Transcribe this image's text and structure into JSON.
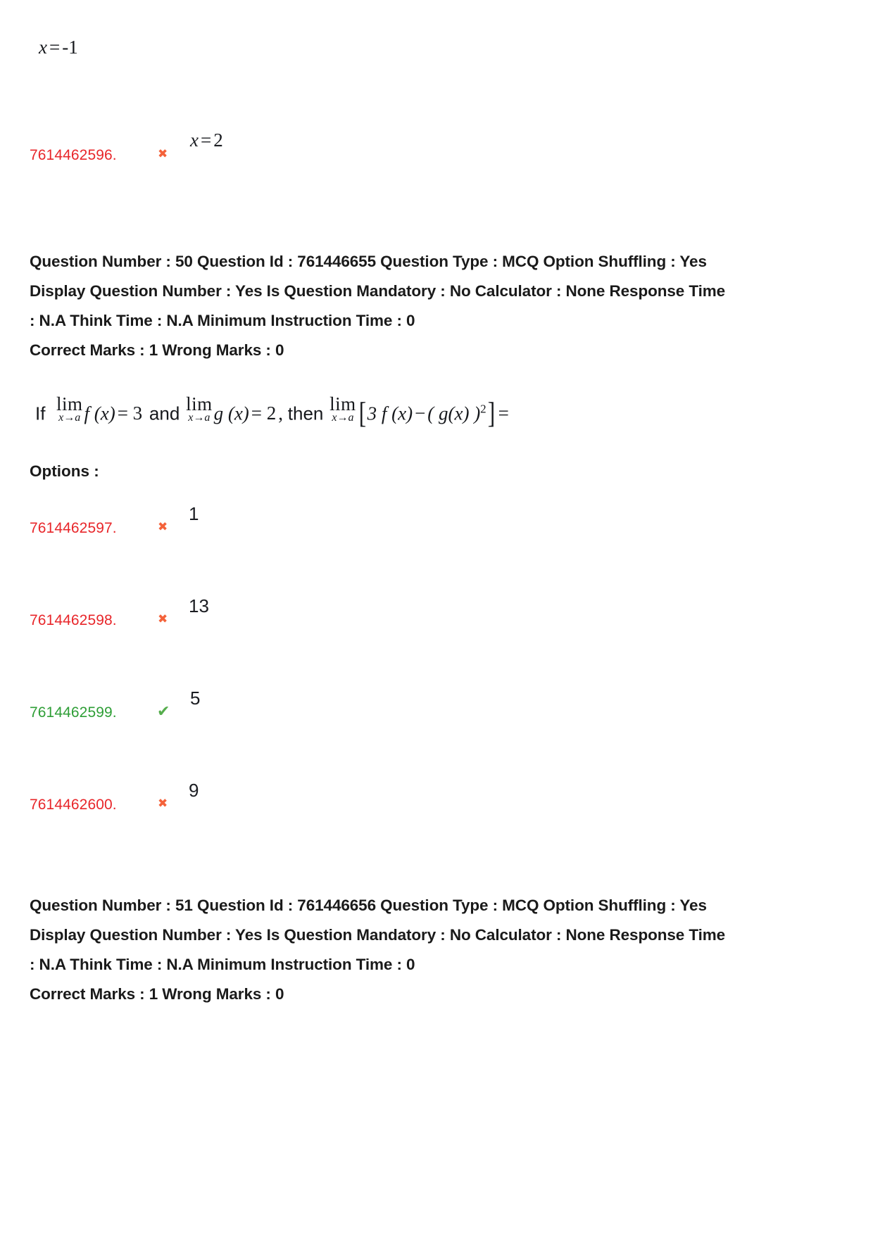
{
  "page": {
    "background": "#ffffff",
    "colors": {
      "wrong_id": "#e8262a",
      "correct_id": "#2e9e36",
      "cross_icon": "#f4623a",
      "tick_icon": "#55ad4c",
      "text": "#1a1a1a"
    }
  },
  "top_fragment": {
    "equation_text": "x = -1",
    "equation_lhs": "x",
    "equation_rhs": "-1",
    "option": {
      "id": "7614462596.",
      "status": "wrong",
      "icon": "cross-icon",
      "value_lhs": "x",
      "value_rhs": "2",
      "value_text": "x = 2"
    }
  },
  "question_50": {
    "meta_line_1": "Question Number : 50 Question Id : 761446655 Question Type : MCQ Option Shuffling : Yes",
    "meta_line_2": "Display Question Number : Yes Is Question Mandatory : No Calculator : None Response Time",
    "meta_line_3": ": N.A Think Time : N.A Minimum Instruction Time : 0",
    "meta_line_4": "Correct Marks : 1 Wrong Marks : 0",
    "fields": {
      "question_number": "50",
      "question_id": "761446655",
      "question_type": "MCQ",
      "option_shuffling": "Yes",
      "display_question_number": "Yes",
      "is_question_mandatory": "No",
      "calculator": "None",
      "response_time": "N.A",
      "think_time": "N.A",
      "minimum_instruction_time": "0",
      "correct_marks": "1",
      "wrong_marks": "0"
    },
    "body": {
      "if_word": "If",
      "lim_op": "lim",
      "lim_sub": "x→a",
      "f_of_x": "f (x)",
      "equals_3": "= 3",
      "and_word": "and",
      "g_of_x": "g (x)",
      "equals_2": "= 2",
      "comma": ",",
      "then_word": "then",
      "bracket_open": "[",
      "expr_3f": "3 f (x)",
      "minus": "−",
      "expr_g": "( g(x) )",
      "exponent": "2",
      "bracket_close": "]",
      "trailing_equals": "=",
      "plain_text": "If lim(x→a) f(x) = 3 and lim(x→a) g(x) = 2 , then lim(x→a) [ 3f(x) − (g(x))² ] ="
    },
    "options_label": "Options :",
    "options": [
      {
        "id": "7614462597.",
        "value": "1",
        "status": "wrong",
        "icon": "cross-icon"
      },
      {
        "id": "7614462598.",
        "value": "13",
        "status": "wrong",
        "icon": "cross-icon"
      },
      {
        "id": "7614462599.",
        "value": "5",
        "status": "correct",
        "icon": "check-icon"
      },
      {
        "id": "7614462600.",
        "value": "9",
        "status": "wrong",
        "icon": "cross-icon"
      }
    ]
  },
  "question_51": {
    "meta_line_1": "Question Number : 51 Question Id : 761446656 Question Type : MCQ Option Shuffling : Yes",
    "meta_line_2": "Display Question Number : Yes Is Question Mandatory : No Calculator : None Response Time",
    "meta_line_3": ": N.A Think Time : N.A Minimum Instruction Time : 0",
    "meta_line_4": "Correct Marks : 1 Wrong Marks : 0",
    "fields": {
      "question_number": "51",
      "question_id": "761446656",
      "question_type": "MCQ",
      "option_shuffling": "Yes",
      "display_question_number": "Yes",
      "is_question_mandatory": "No",
      "calculator": "None",
      "response_time": "N.A",
      "think_time": "N.A",
      "minimum_instruction_time": "0",
      "correct_marks": "1",
      "wrong_marks": "0"
    }
  }
}
